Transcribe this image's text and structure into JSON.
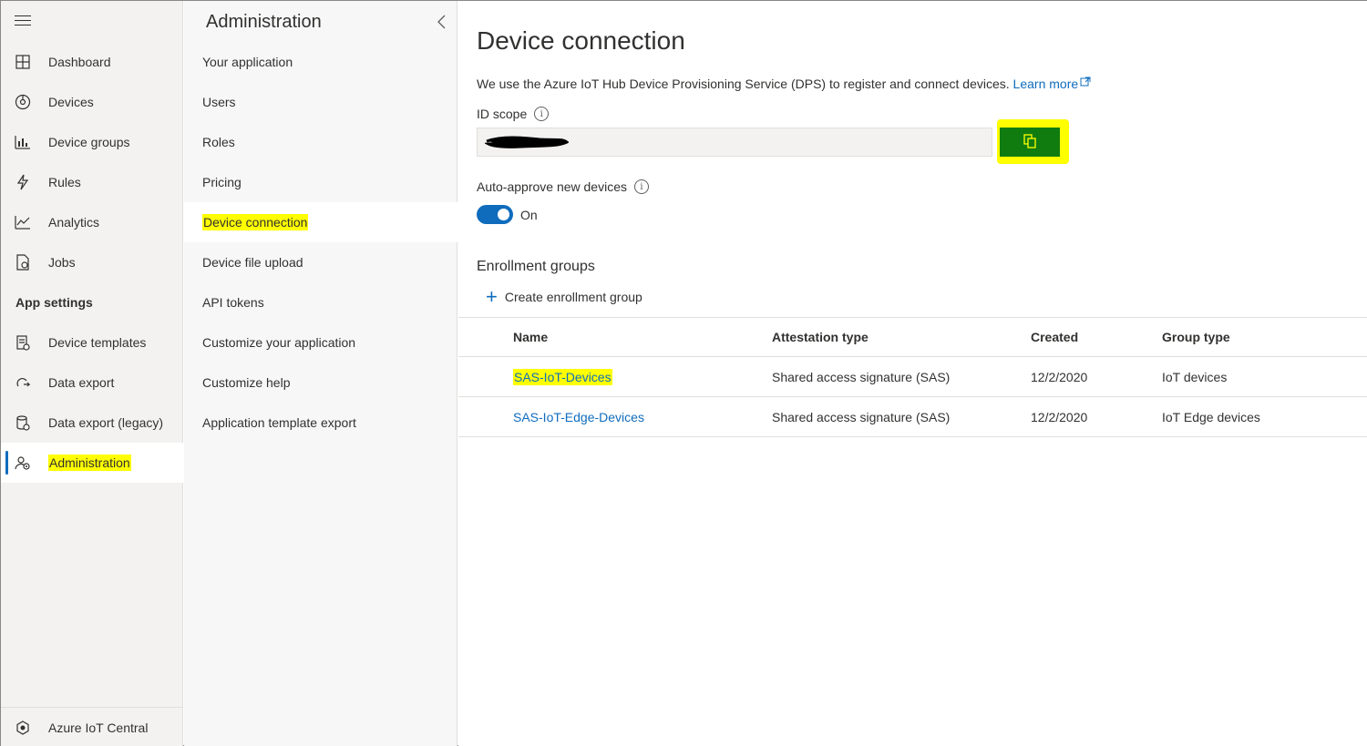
{
  "leftnav": {
    "items": [
      {
        "label": "Dashboard",
        "icon": "dashboard-icon"
      },
      {
        "label": "Devices",
        "icon": "devices-icon"
      },
      {
        "label": "Device groups",
        "icon": "device-groups-icon"
      },
      {
        "label": "Rules",
        "icon": "rules-icon"
      },
      {
        "label": "Analytics",
        "icon": "analytics-icon"
      },
      {
        "label": "Jobs",
        "icon": "jobs-icon"
      }
    ],
    "section_label": "App settings",
    "settings_items": [
      {
        "label": "Device templates",
        "icon": "device-templates-icon"
      },
      {
        "label": "Data export",
        "icon": "data-export-icon"
      },
      {
        "label": "Data export (legacy)",
        "icon": "data-export-legacy-icon"
      },
      {
        "label": "Administration",
        "icon": "administration-icon"
      }
    ],
    "footer_label": "Azure IoT Central"
  },
  "subnav": {
    "title": "Administration",
    "items": [
      "Your application",
      "Users",
      "Roles",
      "Pricing",
      "Device connection",
      "Device file upload",
      "API tokens",
      "Customize your application",
      "Customize help",
      "Application template export"
    ]
  },
  "main": {
    "title": "Device connection",
    "description": "We use the Azure IoT Hub Device Provisioning Service (DPS) to register and connect devices.",
    "learn_more": "Learn more",
    "id_scope_label": "ID scope",
    "auto_approve_label": "Auto-approve new devices",
    "auto_approve_state": "On",
    "enrollment_title": "Enrollment groups",
    "create_label": "Create enrollment group",
    "table": {
      "headers": [
        "Name",
        "Attestation type",
        "Created",
        "Group type"
      ],
      "rows": [
        {
          "name": "SAS-IoT-Devices",
          "attestation": "Shared access signature (SAS)",
          "created": "12/2/2020",
          "group_type": "IoT devices"
        },
        {
          "name": "SAS-IoT-Edge-Devices",
          "attestation": "Shared access signature (SAS)",
          "created": "12/2/2020",
          "group_type": "IoT Edge devices"
        }
      ]
    }
  },
  "colors": {
    "accent": "#0f6cbd",
    "highlight": "#ffff00",
    "copy_button": "#107c10"
  }
}
